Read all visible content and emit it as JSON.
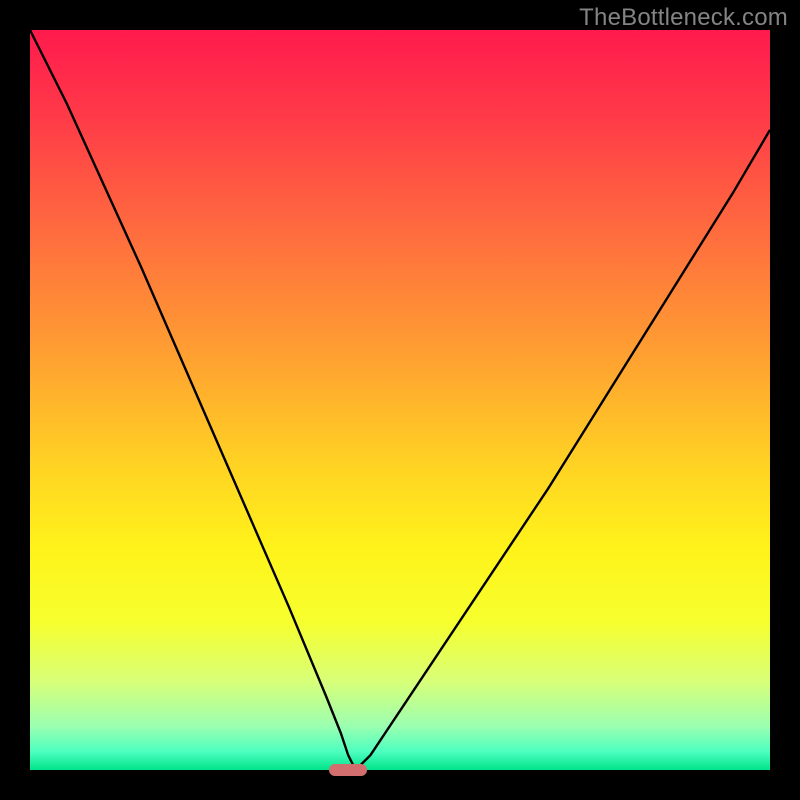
{
  "watermark": "TheBottleneck.com",
  "chart_data": {
    "type": "line",
    "title": "",
    "xlabel": "",
    "ylabel": "",
    "xlim": [
      0,
      100
    ],
    "ylim": [
      0,
      100
    ],
    "grid": false,
    "legend": false,
    "series": [
      {
        "name": "curve",
        "x": [
          0,
          5,
          10,
          15,
          20,
          25,
          30,
          35,
          40,
          41,
          42,
          43,
          44,
          46,
          48,
          50,
          55,
          60,
          65,
          70,
          75,
          80,
          85,
          90,
          95,
          100
        ],
        "y": [
          100,
          90,
          79,
          68,
          56.5,
          45,
          33.5,
          22,
          10,
          7.5,
          5,
          2,
          0,
          2,
          5,
          8,
          15.5,
          23,
          30.5,
          38,
          46,
          54,
          62,
          70,
          78,
          86.5
        ]
      }
    ],
    "marker": {
      "x": 43,
      "y": 0
    },
    "background_gradient": {
      "stops": [
        {
          "offset": 0.0,
          "color": "#ff1a4d"
        },
        {
          "offset": 0.12,
          "color": "#ff3b48"
        },
        {
          "offset": 0.28,
          "color": "#ff6e3e"
        },
        {
          "offset": 0.44,
          "color": "#ffa031"
        },
        {
          "offset": 0.58,
          "color": "#ffd024"
        },
        {
          "offset": 0.7,
          "color": "#fff31a"
        },
        {
          "offset": 0.8,
          "color": "#f6ff2e"
        },
        {
          "offset": 0.88,
          "color": "#d8ff78"
        },
        {
          "offset": 0.94,
          "color": "#9cffb0"
        },
        {
          "offset": 0.975,
          "color": "#4effc0"
        },
        {
          "offset": 1.0,
          "color": "#00e48a"
        }
      ]
    },
    "colors": {
      "curve": "#000000",
      "marker": "#d36e6e",
      "frame": "#000000"
    }
  }
}
